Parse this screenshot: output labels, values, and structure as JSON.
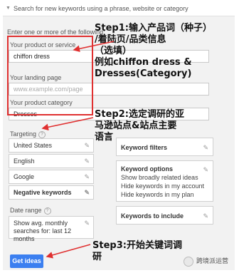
{
  "header": {
    "text": "Search for new keywords using a phrase, website or category"
  },
  "form": {
    "prompt": "Enter one or more of the following:",
    "product_label": "Your product or service",
    "product_value": "chiffon dress",
    "landing_label": "Your landing page",
    "landing_placeholder": "www.example.com/page",
    "category_label": "Your product category",
    "category_value": "Dresses"
  },
  "targeting": {
    "label": "Targeting",
    "items": [
      "United States",
      "English",
      "Google",
      "Negative keywords"
    ]
  },
  "date_range": {
    "label": "Date range",
    "text": "Show avg. monthly searches for: last 12 months"
  },
  "filters": {
    "keyword_filters": "Keyword filters",
    "keyword_options_title": "Keyword options",
    "keyword_options_lines": [
      "Show broadly related ideas",
      "Hide keywords in my account",
      "Hide keywords in my plan"
    ],
    "keywords_to_include": "Keywords to include"
  },
  "get_ideas_label": "Get ideas",
  "annotations": {
    "step1_lines": [
      "Step1:输入产品词（种子）",
      "/着陆页/品类信息",
      "（选填）",
      "例如chiffon dress &",
      "Dresses(Category)"
    ],
    "step2_lines": [
      "Step2:选定调研的亚",
      "马逊站点&站点主要",
      "语言"
    ],
    "step3_lines": [
      "Step3:开始关键词调",
      "研"
    ]
  },
  "watermark": "跨境派运营"
}
